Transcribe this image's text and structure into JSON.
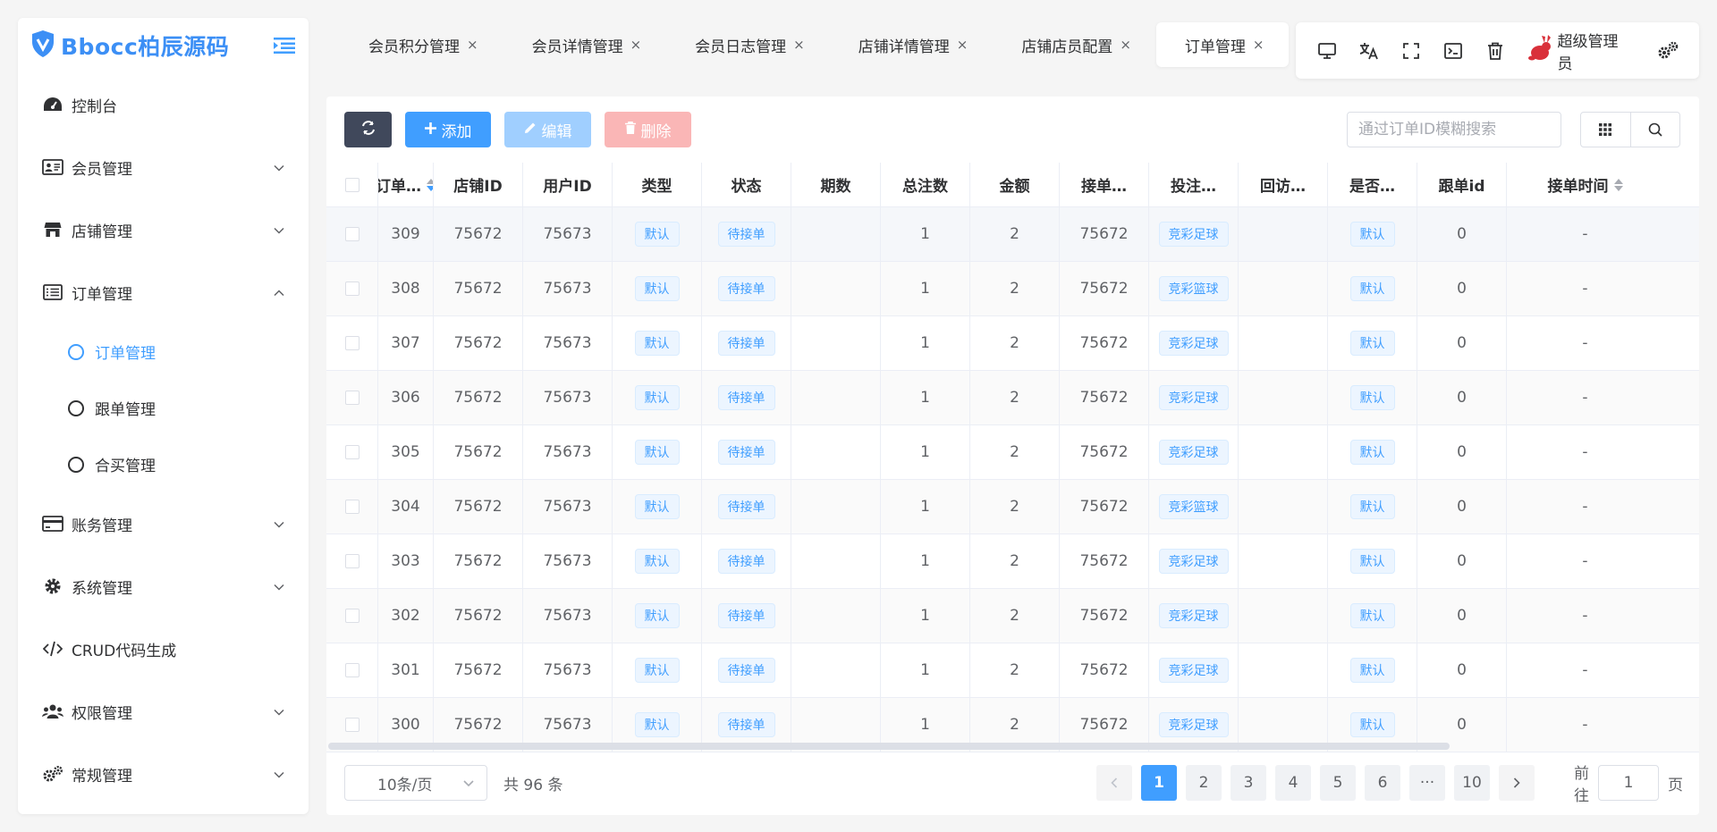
{
  "app": {
    "logo_text": "Bbocc柏辰源码"
  },
  "sidebar": {
    "items": [
      {
        "label": "控制台",
        "icon": "dashboard-icon",
        "has_children": false
      },
      {
        "label": "会员管理",
        "icon": "id-card-icon",
        "has_children": true,
        "expanded": false
      },
      {
        "label": "店铺管理",
        "icon": "store-icon",
        "has_children": true,
        "expanded": false
      },
      {
        "label": "订单管理",
        "icon": "list-icon",
        "has_children": true,
        "expanded": true,
        "children": [
          {
            "label": "订单管理",
            "active": true
          },
          {
            "label": "跟单管理",
            "active": false
          },
          {
            "label": "合买管理",
            "active": false
          }
        ]
      },
      {
        "label": "账务管理",
        "icon": "credit-card-icon",
        "has_children": true,
        "expanded": false
      },
      {
        "label": "系统管理",
        "icon": "gear-icon",
        "has_children": true,
        "expanded": false
      },
      {
        "label": "CRUD代码生成",
        "icon": "code-icon",
        "has_children": false
      },
      {
        "label": "权限管理",
        "icon": "users-icon",
        "has_children": true,
        "expanded": false
      },
      {
        "label": "常规管理",
        "icon": "gears-icon",
        "has_children": true,
        "expanded": false
      }
    ]
  },
  "tabs": [
    {
      "label": "会员积分管理",
      "active": false
    },
    {
      "label": "会员详情管理",
      "active": false
    },
    {
      "label": "会员日志管理",
      "active": false
    },
    {
      "label": "店铺详情管理",
      "active": false
    },
    {
      "label": "店铺店员配置",
      "active": false
    },
    {
      "label": "订单管理",
      "active": true
    }
  ],
  "tab_close_glyph": "×",
  "header": {
    "user_name": "超级管理员"
  },
  "toolbar": {
    "add_label": "添加",
    "edit_label": "编辑",
    "delete_label": "删除",
    "search_placeholder": "通过订单ID模糊搜索"
  },
  "table": {
    "columns": [
      "订单…",
      "店铺ID",
      "用户ID",
      "类型",
      "状态",
      "期数",
      "总注数",
      "金额",
      "接单…",
      "投注…",
      "回访…",
      "是否…",
      "跟单id",
      "接单时间"
    ],
    "rows": [
      [
        "309",
        "75672",
        "75673",
        "默认",
        "待接单",
        "",
        "1",
        "2",
        "75672",
        "竞彩足球",
        "",
        "默认",
        "0",
        "-"
      ],
      [
        "308",
        "75672",
        "75673",
        "默认",
        "待接单",
        "",
        "1",
        "2",
        "75672",
        "竞彩篮球",
        "",
        "默认",
        "0",
        "-"
      ],
      [
        "307",
        "75672",
        "75673",
        "默认",
        "待接单",
        "",
        "1",
        "2",
        "75672",
        "竞彩足球",
        "",
        "默认",
        "0",
        "-"
      ],
      [
        "306",
        "75672",
        "75673",
        "默认",
        "待接单",
        "",
        "1",
        "2",
        "75672",
        "竞彩足球",
        "",
        "默认",
        "0",
        "-"
      ],
      [
        "305",
        "75672",
        "75673",
        "默认",
        "待接单",
        "",
        "1",
        "2",
        "75672",
        "竞彩足球",
        "",
        "默认",
        "0",
        "-"
      ],
      [
        "304",
        "75672",
        "75673",
        "默认",
        "待接单",
        "",
        "1",
        "2",
        "75672",
        "竞彩篮球",
        "",
        "默认",
        "0",
        "-"
      ],
      [
        "303",
        "75672",
        "75673",
        "默认",
        "待接单",
        "",
        "1",
        "2",
        "75672",
        "竞彩足球",
        "",
        "默认",
        "0",
        "-"
      ],
      [
        "302",
        "75672",
        "75673",
        "默认",
        "待接单",
        "",
        "1",
        "2",
        "75672",
        "竞彩足球",
        "",
        "默认",
        "0",
        "-"
      ],
      [
        "301",
        "75672",
        "75673",
        "默认",
        "待接单",
        "",
        "1",
        "2",
        "75672",
        "竞彩足球",
        "",
        "默认",
        "0",
        "-"
      ],
      [
        "300",
        "75672",
        "75673",
        "默认",
        "待接单",
        "",
        "1",
        "2",
        "75672",
        "竞彩足球",
        "",
        "默认",
        "0",
        "-"
      ]
    ]
  },
  "pagination": {
    "page_size_label": "10条/页",
    "total_label": "共 96 条",
    "pages": [
      "1",
      "2",
      "3",
      "4",
      "5",
      "6",
      "···",
      "10"
    ],
    "current_page": "1",
    "goto_label": "前往",
    "goto_value": "1",
    "page_unit": "页"
  },
  "colors": {
    "primary": "#409eff",
    "dark_button": "#40485b",
    "danger_disabled": "#fab6b6",
    "primary_disabled": "#a0cfff"
  }
}
